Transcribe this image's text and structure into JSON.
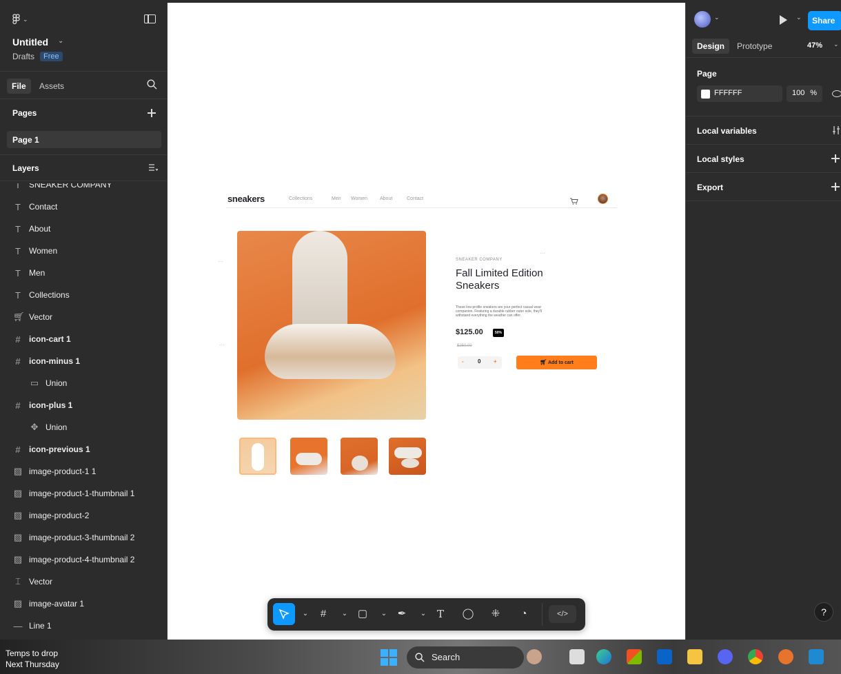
{
  "left": {
    "file_title": "Untitled",
    "drafts": "Drafts",
    "plan": "Free",
    "tabs": {
      "file": "File",
      "assets": "Assets"
    },
    "pages_header": "Pages",
    "page": "Page 1",
    "layers_header": "Layers",
    "layers": [
      {
        "label": "SNEAKER COMPANY",
        "icon": "T",
        "bold": false,
        "indent": false
      },
      {
        "label": "Contact",
        "icon": "T",
        "bold": false,
        "indent": false
      },
      {
        "label": "About",
        "icon": "T",
        "bold": false,
        "indent": false
      },
      {
        "label": "Women",
        "icon": "T",
        "bold": false,
        "indent": false
      },
      {
        "label": "Men",
        "icon": "T",
        "bold": false,
        "indent": false
      },
      {
        "label": "Collections",
        "icon": "T",
        "bold": false,
        "indent": false
      },
      {
        "label": "Vector",
        "icon": "cart",
        "bold": false,
        "indent": false
      },
      {
        "label": "icon-cart 1",
        "icon": "#",
        "bold": true,
        "indent": false
      },
      {
        "label": "icon-minus 1",
        "icon": "#",
        "bold": true,
        "indent": false
      },
      {
        "label": "Union",
        "icon": "rect",
        "bold": false,
        "indent": true
      },
      {
        "label": "icon-plus 1",
        "icon": "#",
        "bold": true,
        "indent": false
      },
      {
        "label": "Union",
        "icon": "cross",
        "bold": false,
        "indent": true
      },
      {
        "label": "icon-previous 1",
        "icon": "#",
        "bold": true,
        "indent": false
      },
      {
        "label": "image-product-1 1",
        "icon": "image",
        "bold": false,
        "indent": false
      },
      {
        "label": "image-product-1-thumbnail 1",
        "icon": "image",
        "bold": false,
        "indent": false
      },
      {
        "label": "image-product-2",
        "icon": "image",
        "bold": false,
        "indent": false
      },
      {
        "label": "image-product-3-thumbnail 2",
        "icon": "image",
        "bold": false,
        "indent": false
      },
      {
        "label": "image-product-4-thumbnail 2",
        "icon": "image",
        "bold": false,
        "indent": false
      },
      {
        "label": "Vector",
        "icon": "H",
        "bold": false,
        "indent": false
      },
      {
        "label": "image-avatar 1",
        "icon": "image",
        "bold": false,
        "indent": false
      },
      {
        "label": "Line 1",
        "icon": "line",
        "bold": false,
        "indent": false
      }
    ]
  },
  "right": {
    "share": "Share",
    "tabs": {
      "design": "Design",
      "prototype": "Prototype"
    },
    "zoom": "47%",
    "page_header": "Page",
    "bg_hex": "FFFFFF",
    "bg_opacity": "100",
    "pct_sign": "%",
    "local_variables": "Local variables",
    "local_styles": "Local styles",
    "export": "Export"
  },
  "design": {
    "brand": "sneakers",
    "nav": [
      "Collections",
      "Men",
      "Women",
      "About",
      "Contact"
    ],
    "company": "SNEAKER COMPANY",
    "title_line1": "Fall Limited Edition",
    "title_line2": "Sneakers",
    "description": "These low-profile sneakers are your perfect casual wear companion. Featuring a durable rubber outer sole, they'll withstand everything the weather can offer.",
    "price": "$125.00",
    "discount": "50%",
    "old_price": "$250.00",
    "qty_minus": "-",
    "qty_value": "0",
    "qty_plus": "+",
    "add_to_cart": "Add to cart"
  },
  "taskbar": {
    "weather_line1": "Temps to drop",
    "weather_line2": "Next Thursday",
    "search": "Search"
  },
  "help": "?",
  "colors": {
    "accent": "#0d99ff",
    "orange": "#ff7d1a",
    "panel": "#2c2c2c"
  }
}
